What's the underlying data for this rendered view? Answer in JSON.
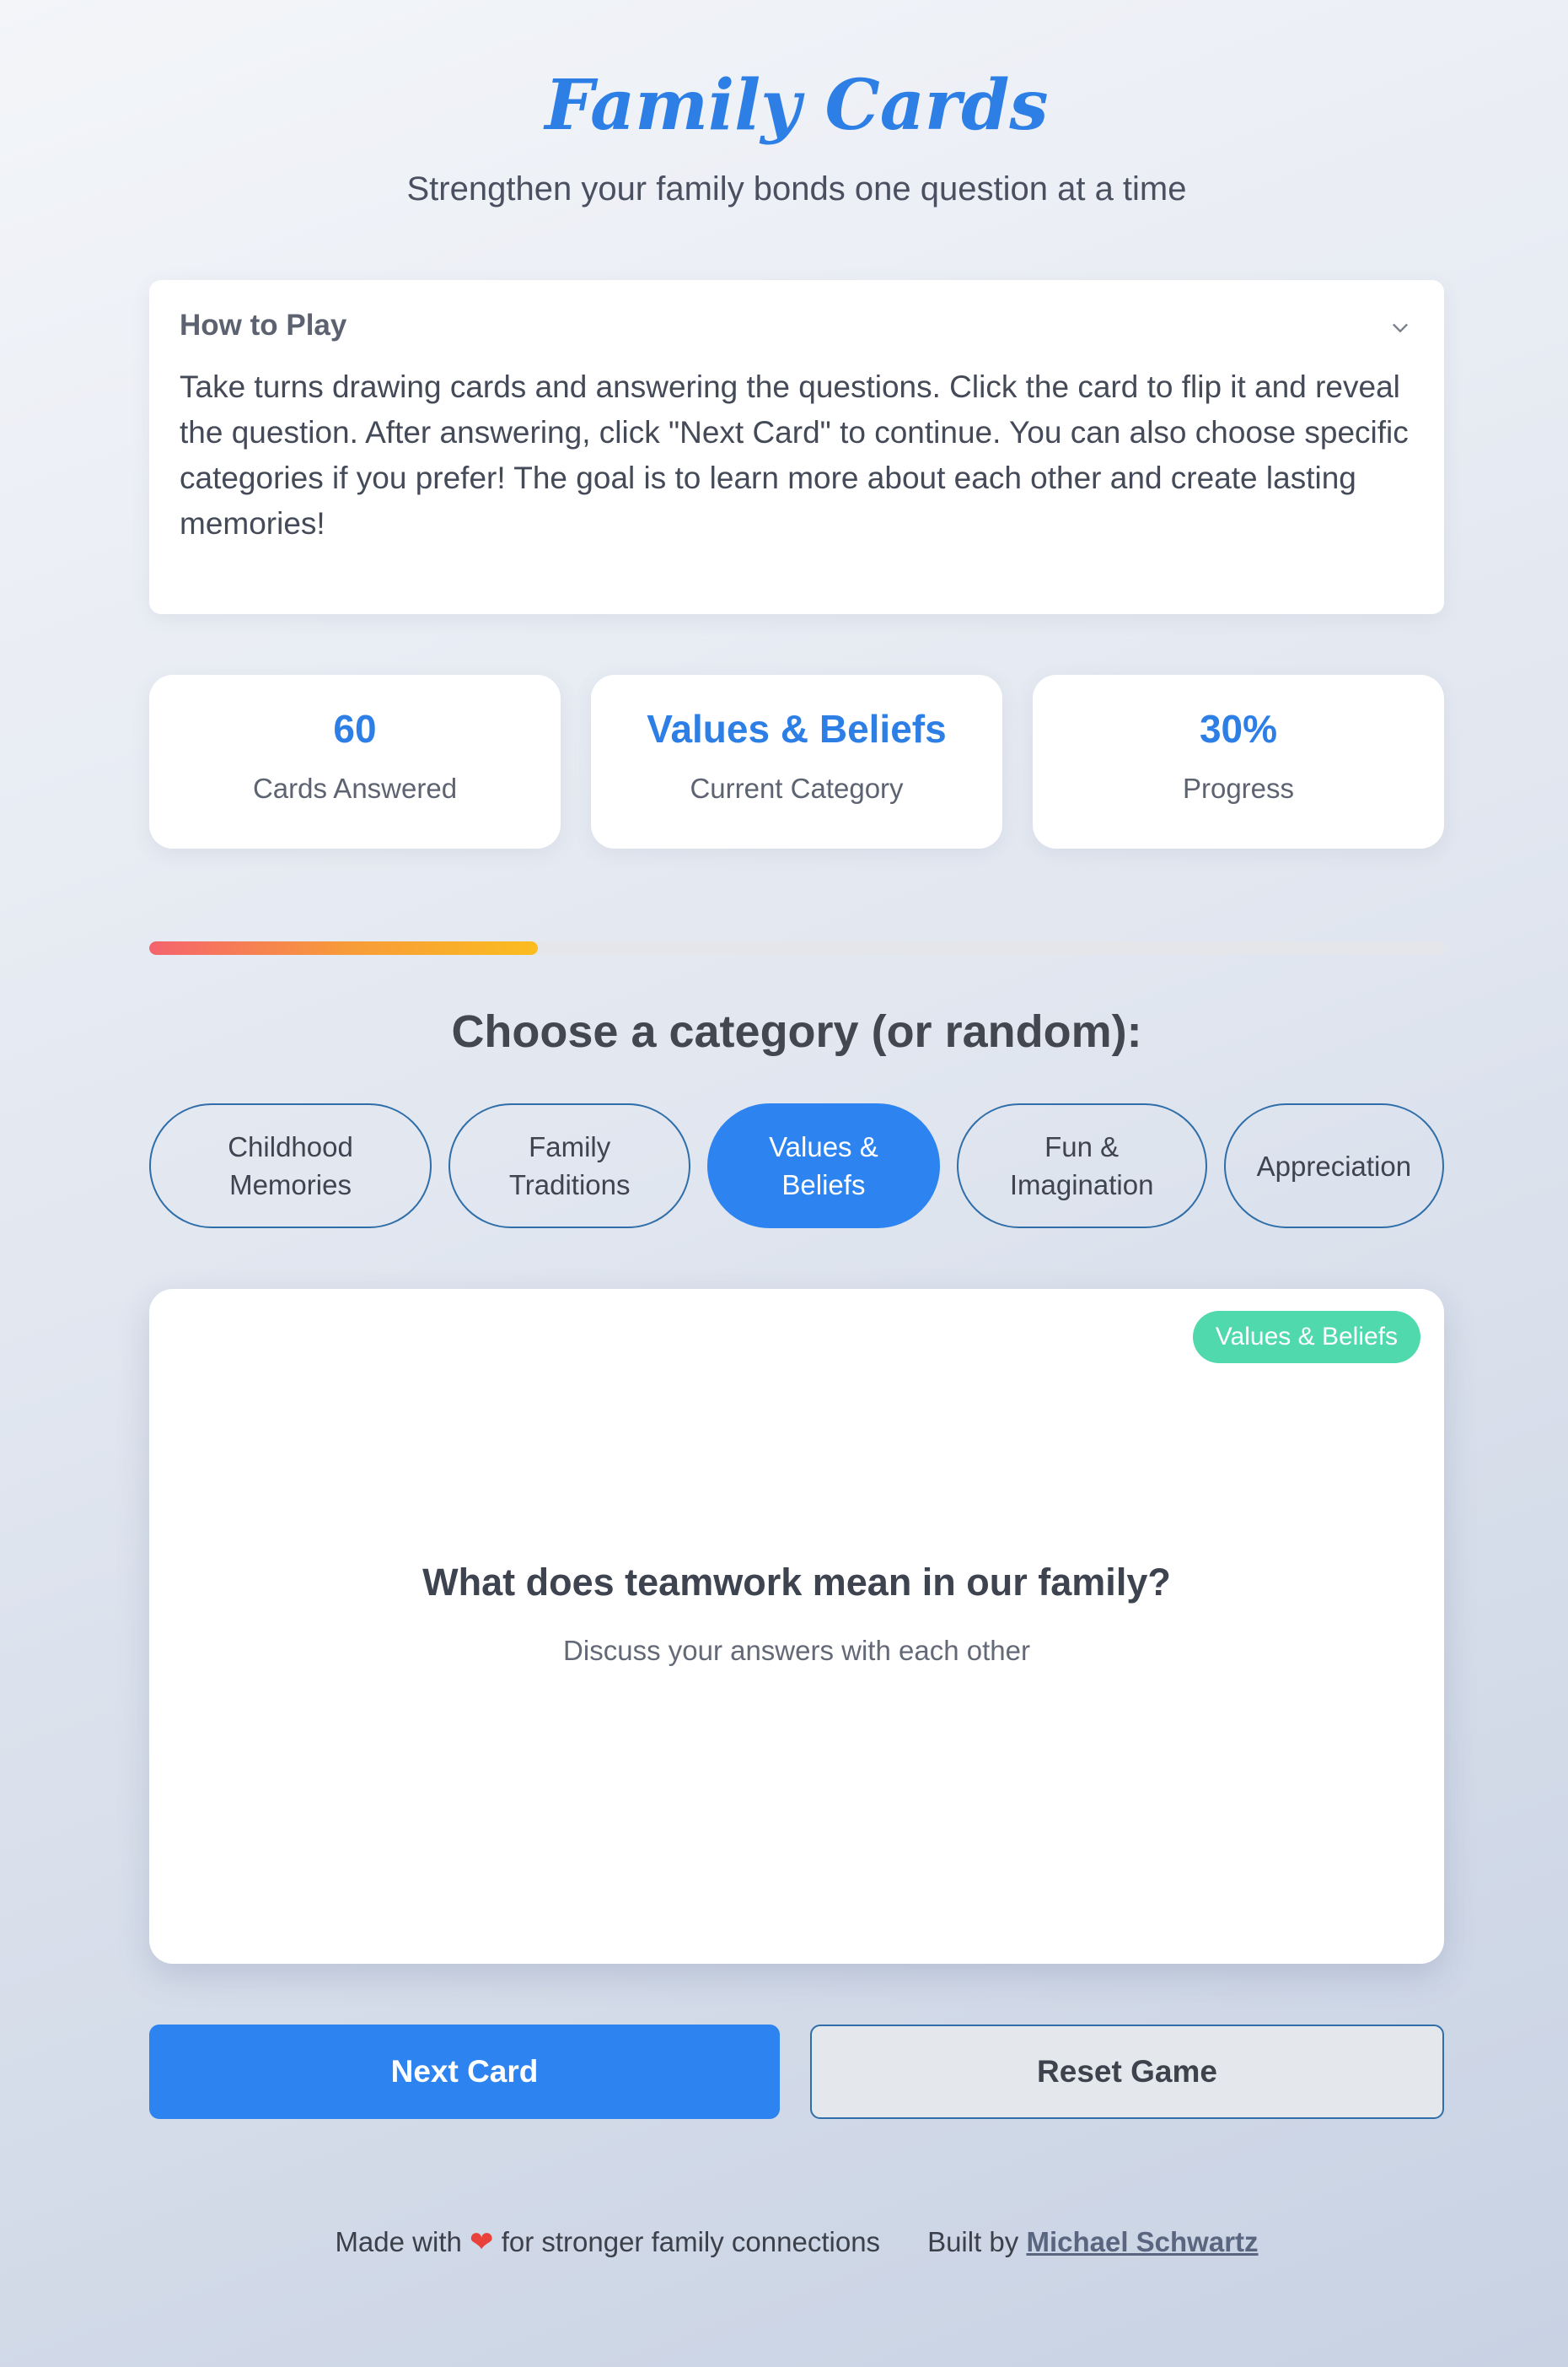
{
  "header": {
    "title": "Family Cards",
    "subtitle": "Strengthen your family bonds one question at a time"
  },
  "how_to_play": {
    "heading": "How to Play",
    "toggle_icon": "chevron-down-icon",
    "text": "Take turns drawing cards and answering the questions. Click the card to flip it and reveal the question. After answering, click \"Next Card\" to continue. You can also choose specific categories if you prefer! The goal is to learn more about each other and create lasting memories!"
  },
  "stats": [
    {
      "value": "60",
      "label": "Cards Answered"
    },
    {
      "value": "Values & Beliefs",
      "label": "Current Category"
    },
    {
      "value": "30%",
      "label": "Progress"
    }
  ],
  "progress": {
    "percent": 30
  },
  "categories": {
    "heading": "Choose a category (or random):",
    "items": [
      {
        "label": "Childhood Memories",
        "active": false
      },
      {
        "label": "Family Traditions",
        "active": false
      },
      {
        "label": "Values & Beliefs",
        "active": true
      },
      {
        "label": "Fun & Imagination",
        "active": false
      },
      {
        "label": "Appreciation",
        "active": false
      }
    ]
  },
  "card": {
    "badge": "Values & Beliefs",
    "question": "What does teamwork mean in our family?",
    "hint": "Discuss your answers with each other"
  },
  "actions": {
    "next_label": "Next Card",
    "reset_label": "Reset Game"
  },
  "footer": {
    "made_prefix": "Made with",
    "heart_icon": "heart-icon",
    "made_suffix": "for stronger family connections",
    "built_prefix": "Built by",
    "author": "Michael Schwartz"
  },
  "colors": {
    "accent": "#2d84f0",
    "title": "#2d7fe6",
    "badge": "#4fd9ad",
    "heart": "#e8423a"
  }
}
